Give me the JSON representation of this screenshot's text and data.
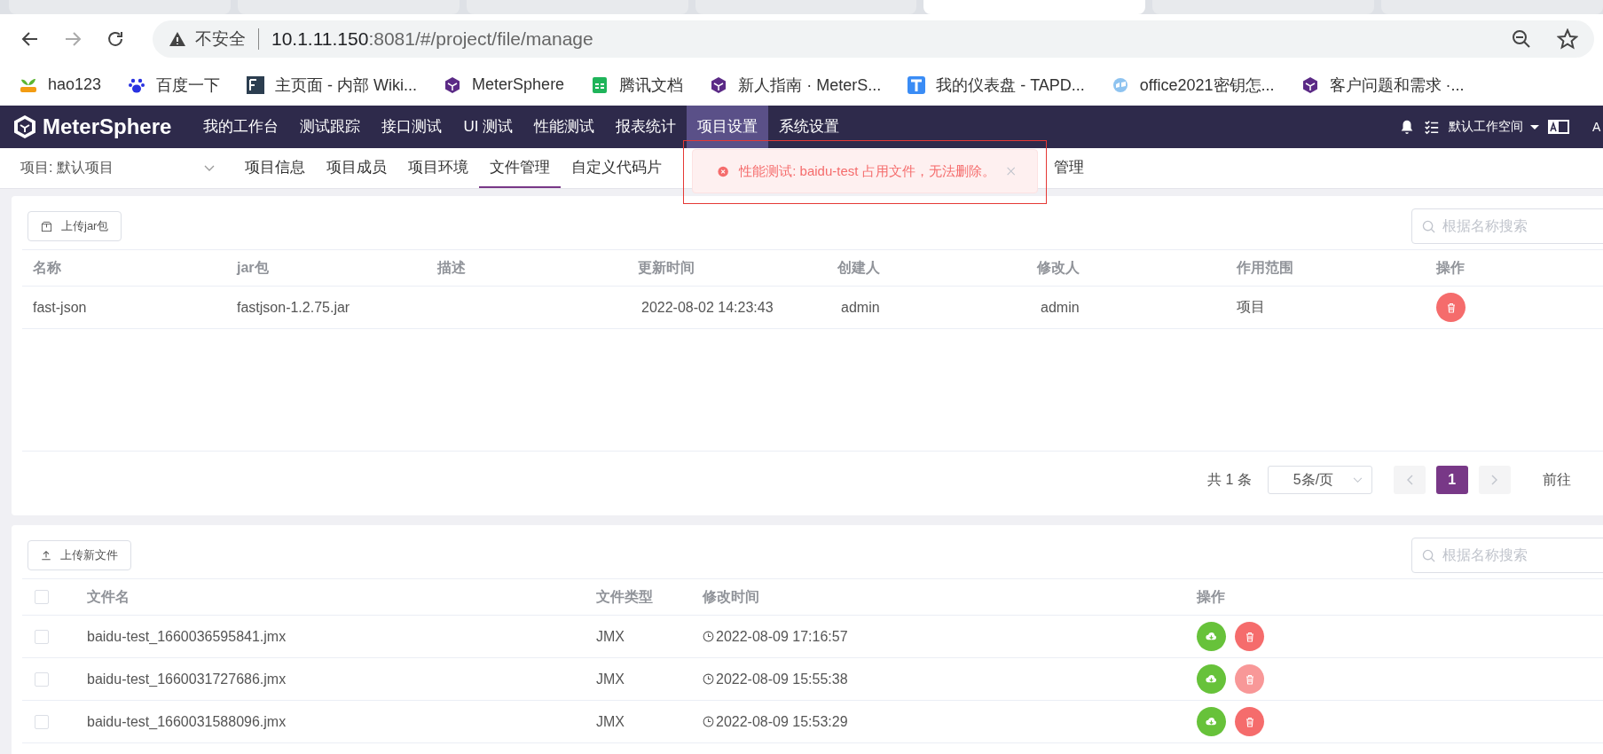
{
  "browser": {
    "address": {
      "security": "不安全",
      "host": "10.1.11.150",
      "rest": ":8081/#/project/file/manage"
    },
    "bookmarks": [
      {
        "label": "hao123",
        "kind": "leaf"
      },
      {
        "label": "百度一下",
        "kind": "paw"
      },
      {
        "label": "主页面 - 内部 Wiki...",
        "kind": "square"
      },
      {
        "label": "MeterSphere",
        "kind": "cube"
      },
      {
        "label": "腾讯文档",
        "kind": "sheet"
      },
      {
        "label": "新人指南 · MeterS...",
        "kind": "cube"
      },
      {
        "label": "我的仪表盘 - TAPD...",
        "kind": "tlogo"
      },
      {
        "label": "office2021密钥怎...",
        "kind": "globe"
      },
      {
        "label": "客户问题和需求 ·...",
        "kind": "cube"
      }
    ]
  },
  "nav": {
    "logo": "MeterSphere",
    "items": [
      {
        "label": "我的工作台",
        "selected": false
      },
      {
        "label": "测试跟踪",
        "selected": false
      },
      {
        "label": "接口测试",
        "selected": false
      },
      {
        "label": "UI 测试",
        "selected": false
      },
      {
        "label": "性能测试",
        "selected": false
      },
      {
        "label": "报表统计",
        "selected": false
      },
      {
        "label": "项目设置",
        "selected": true
      },
      {
        "label": "系统设置",
        "selected": false
      }
    ],
    "workspace": "默认工作空间",
    "lang_initial": "A"
  },
  "subnav": {
    "project": "项目: 默认项目",
    "tabs": [
      {
        "label": "项目信息",
        "selected": false
      },
      {
        "label": "项目成员",
        "selected": false
      },
      {
        "label": "项目环境",
        "selected": false
      },
      {
        "label": "文件管理",
        "selected": true
      },
      {
        "label": "自定义代码片",
        "selected": false
      },
      {
        "label": "管理",
        "selected": false
      }
    ]
  },
  "toast": {
    "message": "性能测试: baidu-test 占用文件，无法删除。"
  },
  "jar_panel": {
    "upload": "上传jar包",
    "search_placeholder": "根据名称搜索",
    "columns": [
      "名称",
      "jar包",
      "描述",
      "更新时间",
      "创建人",
      "修改人",
      "作用范围",
      "操作"
    ],
    "rows": [
      {
        "cells": [
          "fast-json",
          "fastjson-1.2.75.jar",
          null,
          "2022-08-02 14:23:43",
          "admin",
          "admin",
          "项目"
        ]
      }
    ],
    "pagination": {
      "total": "共 1 条",
      "page_size": "5条/页",
      "pages": [
        {
          "label": "1",
          "selected": true
        }
      ],
      "goto": "前往"
    }
  },
  "file_panel": {
    "upload": "上传新文件",
    "select_all_checked": false,
    "search_placeholder": "根据名称搜索",
    "columns": [
      "文件名",
      "文件类型",
      "修改时间",
      "操作"
    ],
    "rows": [
      {
        "checked": false,
        "name": "baidu-test_1660036595841.jmx",
        "type": "JMX",
        "modified": "2022-08-09 17:16:57",
        "delete_disabled": false
      },
      {
        "checked": false,
        "name": "baidu-test_1660031727686.jmx",
        "type": "JMX",
        "modified": "2022-08-09 15:55:38",
        "delete_disabled": true
      },
      {
        "checked": false,
        "name": "baidu-test_1660031588096.jmx",
        "type": "JMX",
        "modified": "2022-08-09 15:53:29",
        "delete_disabled": false
      }
    ]
  }
}
